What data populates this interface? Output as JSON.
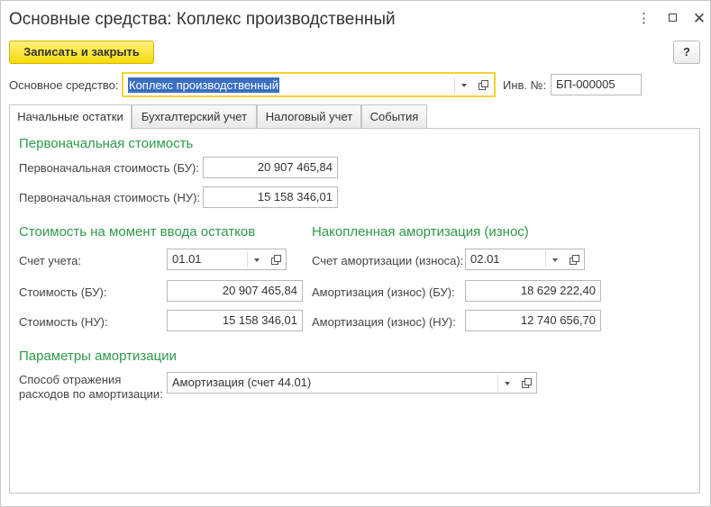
{
  "window": {
    "title": "Основные средства: Коплекс производственный",
    "more_icon": "⋮",
    "close_icon": "✕"
  },
  "toolbar": {
    "save_close_label": "Записать и закрыть",
    "help_label": "?"
  },
  "header": {
    "asset_label": "Основное средство:",
    "asset_value": "Коплекс производственный",
    "inv_label": "Инв. №:",
    "inv_value": "БП-000005"
  },
  "tabs": [
    {
      "label": "Начальные остатки",
      "active": true
    },
    {
      "label": "Бухгалтерский учет",
      "active": false
    },
    {
      "label": "Налоговый учет",
      "active": false
    },
    {
      "label": "События",
      "active": false
    }
  ],
  "initial_cost": {
    "title": "Первоначальная стоимость",
    "bu_label": "Первоначальная стоимость (БУ):",
    "bu_value": "20 907 465,84",
    "nu_label": "Первоначальная стоимость (НУ):",
    "nu_value": "15 158 346,01"
  },
  "entry_cost": {
    "title": "Стоимость на момент ввода остатков",
    "account_label": "Счет учета:",
    "account_value": "01.01",
    "bu_label": "Стоимость (БУ):",
    "bu_value": "20 907 465,84",
    "nu_label": "Стоимость (НУ):",
    "nu_value": "15 158 346,01"
  },
  "depreciation": {
    "title": "Накопленная амортизация (износ)",
    "account_label": "Счет амортизации (износа):",
    "account_value": "02.01",
    "bu_label": "Амортизация (износ) (БУ):",
    "bu_value": "18 629 222,40",
    "nu_label": "Амортизация (износ) (НУ):",
    "nu_value": "12 740 656,70"
  },
  "params": {
    "title": "Параметры амортизации",
    "method_label_line1": "Способ отражения",
    "method_label_line2": "расходов по амортизации:",
    "method_value": "Амортизация (счет 44.01)"
  }
}
